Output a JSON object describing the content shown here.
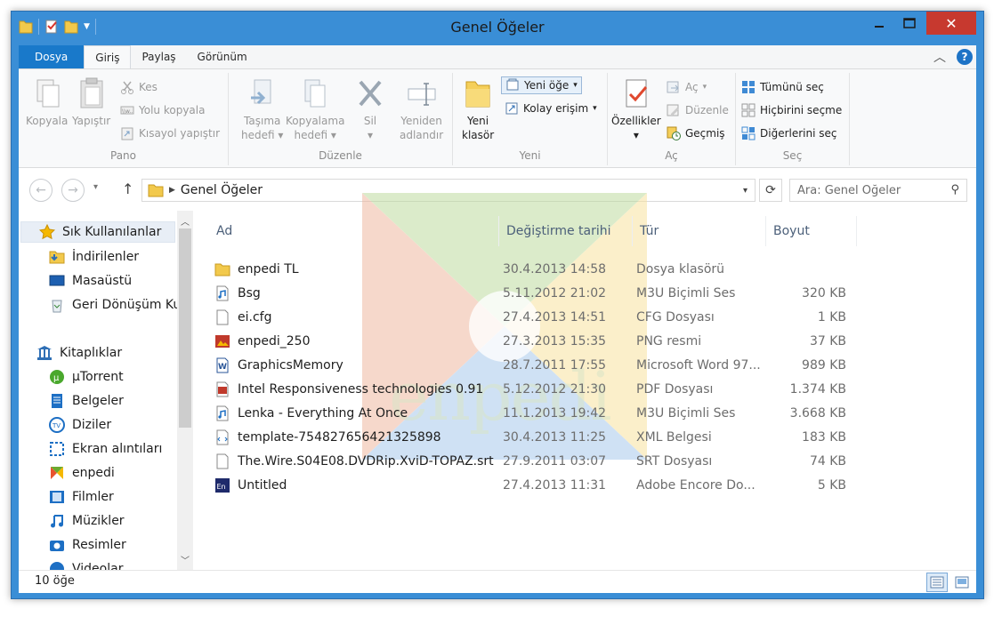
{
  "window": {
    "title": "Genel Öğeler"
  },
  "ribbon_tabs": {
    "file": "Dosya",
    "home": "Giriş",
    "share": "Paylaş",
    "view": "Görünüm"
  },
  "ribbon": {
    "clipboard": {
      "label": "Pano",
      "copy": "Kopyala",
      "paste": "Yapıştır",
      "cut": "Kes",
      "copy_path": "Yolu kopyala",
      "paste_shortcut": "Kısayol yapıştır"
    },
    "organize": {
      "label": "Düzenle",
      "move_to_1": "Taşıma",
      "move_to_2": "hedefi",
      "copy_to_1": "Kopyalama",
      "copy_to_2": "hedefi",
      "delete": "Sil",
      "rename_1": "Yeniden",
      "rename_2": "adlandır"
    },
    "new": {
      "label": "Yeni",
      "new_folder_1": "Yeni",
      "new_folder_2": "klasör",
      "new_item": "Yeni öğe",
      "easy_access": "Kolay erişim"
    },
    "open": {
      "label": "Aç",
      "properties": "Özellikler",
      "open": "Aç",
      "edit": "Düzenle",
      "history": "Geçmiş"
    },
    "select": {
      "label": "Seç",
      "select_all": "Tümünü seç",
      "select_none": "Hiçbirini seçme",
      "invert": "Diğerlerini seç"
    }
  },
  "address": {
    "crumb": "Genel Öğeler",
    "search_placeholder": "Ara: Genel Öğeler"
  },
  "nav": {
    "favorites": "Sık Kullanılanlar",
    "downloads": "İndirilenler",
    "desktop": "Masaüstü",
    "recycle": "Geri Dönüşüm Ku",
    "libraries": "Kitaplıklar",
    "utorrent": "µTorrent",
    "documents": "Belgeler",
    "series": "Diziler",
    "screenshots": "Ekran alıntıları",
    "enpedi": "enpedi",
    "movies": "Filmler",
    "music": "Müzikler",
    "pictures": "Resimler",
    "videos": "Videolar"
  },
  "columns": {
    "name": "Ad",
    "date": "Değiştirme tarihi",
    "type": "Tür",
    "size": "Boyut"
  },
  "files": [
    {
      "name": "enpedi TL",
      "date": "30.4.2013 14:58",
      "type": "Dosya klasörü",
      "size": "",
      "icon": "folder-icon"
    },
    {
      "name": "Bsg",
      "date": "5.11.2012 21:02",
      "type": "M3U Biçimli Ses",
      "size": "320 KB",
      "icon": "audio-file-icon"
    },
    {
      "name": "ei.cfg",
      "date": "27.4.2013 14:51",
      "type": "CFG Dosyası",
      "size": "1 KB",
      "icon": "blank-file-icon"
    },
    {
      "name": "enpedi_250",
      "date": "27.3.2013 15:35",
      "type": "PNG resmi",
      "size": "37 KB",
      "icon": "image-file-icon"
    },
    {
      "name": "GraphicsMemory",
      "date": "28.7.2011 17:55",
      "type": "Microsoft Word 97...",
      "size": "989 KB",
      "icon": "word-file-icon"
    },
    {
      "name": "Intel Responsiveness technologies 0.91",
      "date": "5.12.2012 21:30",
      "type": "PDF Dosyası",
      "size": "1.374 KB",
      "icon": "pdf-file-icon"
    },
    {
      "name": "Lenka - Everything At Once",
      "date": "11.1.2013 19:42",
      "type": "M3U Biçimli Ses",
      "size": "3.668 KB",
      "icon": "audio-file-icon"
    },
    {
      "name": "template-754827656421325898",
      "date": "30.4.2013 11:25",
      "type": "XML Belgesi",
      "size": "183 KB",
      "icon": "xml-file-icon"
    },
    {
      "name": "The.Wire.S04E08.DVDRip.XviD-TOPAZ.srt",
      "date": "27.9.2011 03:07",
      "type": "SRT Dosyası",
      "size": "74 KB",
      "icon": "blank-file-icon"
    },
    {
      "name": "Untitled",
      "date": "27.4.2013 11:31",
      "type": "Adobe Encore Do...",
      "size": "5 KB",
      "icon": "encore-file-icon"
    }
  ],
  "status": {
    "count": "10 öğe"
  },
  "watermark": {
    "text": "enpedi"
  }
}
